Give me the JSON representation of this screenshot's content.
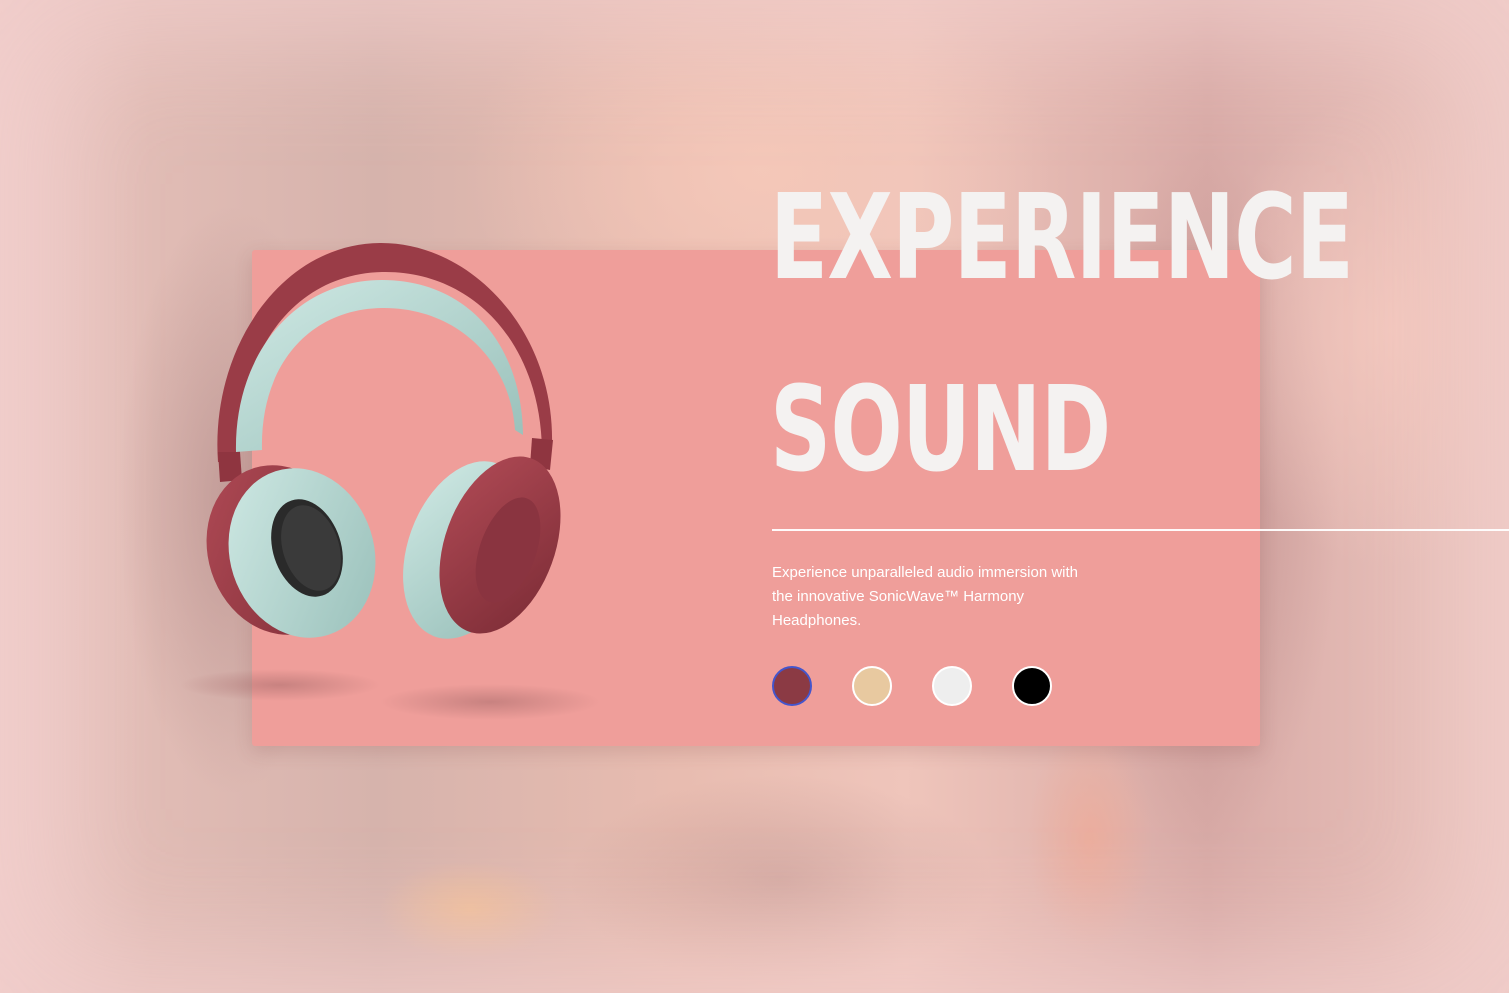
{
  "hero": {
    "headline_line1": "Experience",
    "headline_line2": "Sound",
    "description": "Experience unparalleled audio immersion with the innovative SonicWave™ Harmony Headphones."
  },
  "product": {
    "image_icon": "headphones-icon"
  },
  "colors": {
    "card_background": "#ef9e9a",
    "headline": "#f4f2f1",
    "selected_ring": "#4455cc"
  },
  "color_options": [
    {
      "name": "maroon",
      "hex": "#8b3a44",
      "selected": true
    },
    {
      "name": "beige",
      "hex": "#e8c9a0",
      "selected": false
    },
    {
      "name": "white",
      "hex": "#eeeeee",
      "selected": false
    },
    {
      "name": "black",
      "hex": "#000000",
      "selected": false
    }
  ]
}
